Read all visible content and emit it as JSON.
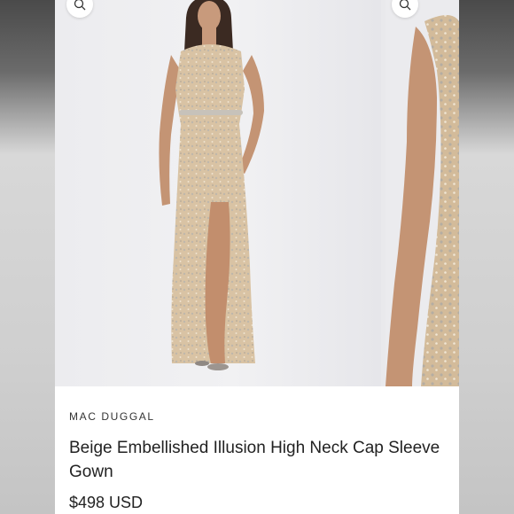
{
  "product": {
    "brand": "MAC DUGGAL",
    "title": "Beige Embellished Illusion High Neck Cap Sleeve Gown",
    "price": "$498 USD"
  },
  "gallery": {
    "images": [
      {
        "name": "gown-front-view",
        "zoom_icon": "zoom-in-icon"
      },
      {
        "name": "gown-detail-view",
        "zoom_icon": "zoom-in-icon"
      }
    ]
  },
  "colors": {
    "gown": "#d8c2a3",
    "sequin": "#b8b2a8",
    "skin": "#c89a7c",
    "background": "#ececef"
  }
}
